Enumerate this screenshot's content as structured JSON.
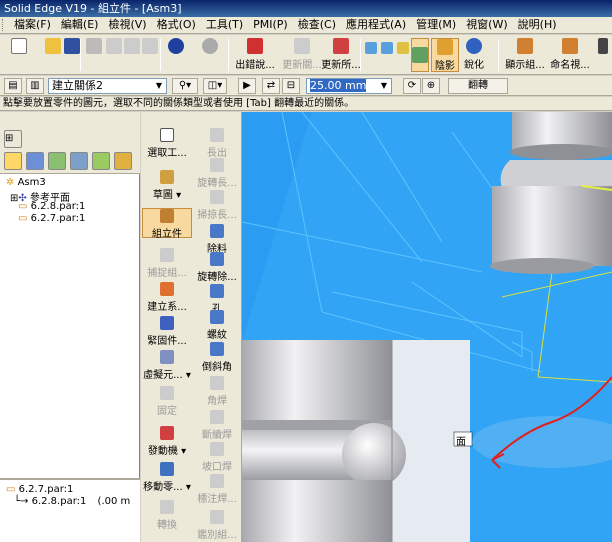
{
  "window": {
    "title": "Solid Edge V19 - 組立件 - [Asm3]"
  },
  "menu": [
    "檔案(F)",
    "編輯(E)",
    "檢視(V)",
    "格式(O)",
    "工具(T)",
    "PMI(P)",
    "檢查(C)",
    "應用程式(A)",
    "管理(M)",
    "視窗(W)",
    "說明(H)"
  ],
  "toolbar": {
    "place_label": "出錯說...",
    "update_links_label": "更新關...",
    "update_all_label": "更新所...",
    "shaded_label": "陰影",
    "sharpen_label": "銳化",
    "display_label": "顯示組...",
    "naming_label": "命名視..."
  },
  "ribbon2": {
    "relation_value": "建立關係2",
    "offset_value": "25.00 mm",
    "flip_label": "翻轉"
  },
  "prompt": "點擊要放置零件的圖元，選取不同的關係類型或者使用 [Tab] 翻轉最近的關係。",
  "tree": {
    "root": "Asm3",
    "ref_planes": "參考平面",
    "part1": "6.2.8.par:1",
    "part2": "6.2.7.par:1"
  },
  "relations": {
    "row1": "6.2.7.par:1",
    "row2_part": "6.2.8.par:1",
    "row2_value": "(.00 m"
  },
  "commands_left": [
    "選取工...",
    "草圖",
    "組立件",
    "捕捉組...",
    "建立系...",
    "緊固件...",
    "虛擬元...",
    "固定",
    "發動機",
    "移動零...",
    "轉換"
  ],
  "commands_right": [
    "長出",
    "旋轉長...",
    "掃掠長...",
    "除料",
    "旋轉除...",
    "孔",
    "螺紋",
    "倒斜角",
    "角焊",
    "斷續焊",
    "坡口焊",
    "標注焊...",
    "鑑別組..."
  ],
  "viewport": {
    "face_label": "面"
  },
  "colors": {
    "accent": "#0a246a",
    "selected": "#f8d9a0",
    "annotation": "#e0201e"
  }
}
